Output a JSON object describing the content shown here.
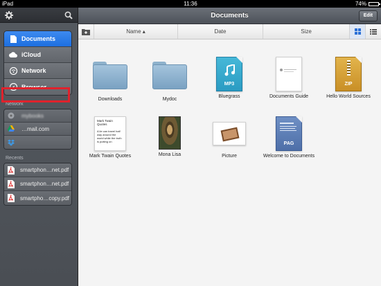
{
  "status_bar": {
    "carrier": "iPad",
    "time": "11:36",
    "battery_text": "74%",
    "battery_level": 0.74
  },
  "sidebar": {
    "places": [
      {
        "label": "Documents",
        "icon": "document-icon",
        "active": true
      },
      {
        "label": "iCloud",
        "icon": "cloud-icon",
        "active": false
      },
      {
        "label": "Network",
        "icon": "wifi-icon",
        "active": false
      },
      {
        "label": "Browser",
        "icon": "compass-icon",
        "active": false
      }
    ],
    "network_section_label": "Network",
    "network_accounts": [
      {
        "label": "mybooks",
        "icon": "server-icon"
      },
      {
        "label": "…mail.com",
        "icon": "google-drive-icon"
      },
      {
        "label": "",
        "icon": "dropbox-icon"
      }
    ],
    "recents_section_label": "Recents",
    "recents": [
      {
        "label": "smartphon…net.pdf",
        "icon": "pdf-icon"
      },
      {
        "label": "smartphon…net.pdf",
        "icon": "pdf-icon"
      },
      {
        "label": "smartpho…copy.pdf",
        "icon": "pdf-icon"
      }
    ]
  },
  "main": {
    "title": "Documents",
    "edit_label": "Edit",
    "columns": {
      "name": "Name ▴",
      "date": "Date",
      "size": "Size"
    },
    "items": [
      {
        "label": "Downloads",
        "kind": "folder"
      },
      {
        "label": "Mydoc",
        "kind": "folder"
      },
      {
        "label": "Bluegrass",
        "kind": "mp3",
        "badge": "MP3"
      },
      {
        "label": "Documents Guide",
        "kind": "doc"
      },
      {
        "label": "Hello World Sources",
        "kind": "zip",
        "badge": "ZIP"
      },
      {
        "label": "Mark Twain Quotes",
        "kind": "note",
        "note_title": "Mark Twain Quotes",
        "note_body": "A lie can travel half way around the world while the truth is putting on"
      },
      {
        "label": "Mona Lisa",
        "kind": "painting"
      },
      {
        "label": "Picture",
        "kind": "picture"
      },
      {
        "label": "Welcome to Documents",
        "kind": "pag",
        "badge": "PAG"
      }
    ]
  },
  "colors": {
    "accent": "#1d6fe0",
    "highlight": "#e0222c"
  }
}
